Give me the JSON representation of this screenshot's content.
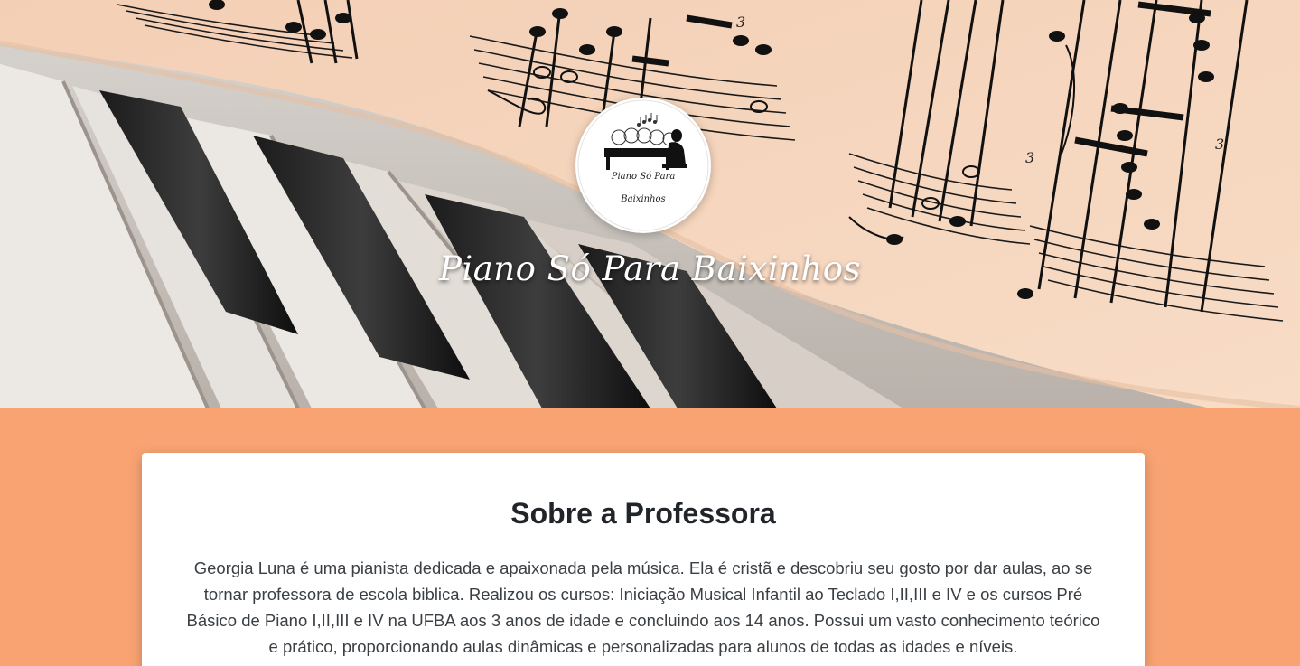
{
  "hero": {
    "logo_line1": "Piano Só Para",
    "logo_line2": "Baixinhos",
    "title": "Piano Só Para Baixinhos"
  },
  "about": {
    "heading": "Sobre a Professora",
    "text": "Georgia Luna é uma pianista dedicada e apaixonada pela música. Ela é cristã e descobriu seu gosto por dar aulas, ao se tornar professora de escola biblica. Realizou os cursos: Iniciação Musical Infantil ao Teclado I,II,III e IV e os cursos Pré Básico de Piano I,II,III e IV na UFBA aos 3 anos de idade e concluindo aos 14 anos. Possui um vasto conhecimento teórico e prático, proporcionando aulas dinâmicas e personalizadas para alunos de todas as idades e níveis."
  },
  "colors": {
    "page_background": "#f9a373",
    "card_background": "#ffffff",
    "sheet_music_paper": "#f6d2b9",
    "title_text": "#ffffff"
  },
  "icons": {
    "hero_background": "piano-sheet-music-photo",
    "logo": "piano-children-logo-icon"
  }
}
